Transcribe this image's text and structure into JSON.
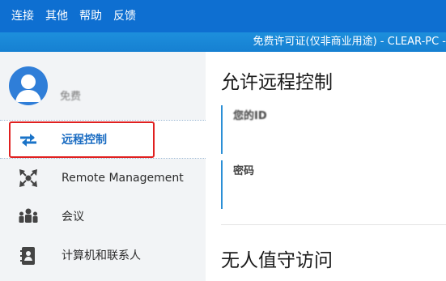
{
  "menubar": {
    "items": [
      "连接",
      "其他",
      "帮助",
      "反馈"
    ]
  },
  "license_bar": {
    "text": "免费许可证(仅非商业用途) - CLEAR-PC -"
  },
  "user": {
    "name": "免费",
    "avatar_icon": "user-icon"
  },
  "sidebar": {
    "items": [
      {
        "label": "远程控制",
        "icon": "arrows-icon",
        "active": true
      },
      {
        "label": "Remote Management",
        "icon": "expand-arrows-icon",
        "active": false
      },
      {
        "label": "会议",
        "icon": "people-icon",
        "active": false
      },
      {
        "label": "计算机和联系人",
        "icon": "contacts-book-icon",
        "active": false
      }
    ]
  },
  "main": {
    "title": "允许远程控制",
    "fields": [
      {
        "label": "您的ID"
      },
      {
        "label": "密码"
      }
    ],
    "section2_title": "无人值守访问"
  },
  "colors": {
    "menubar": "#0e6fd1",
    "accent": "#2b8fd6",
    "highlight_box": "#e02020"
  }
}
